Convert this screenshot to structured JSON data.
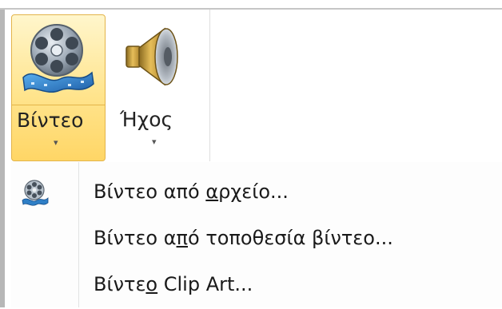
{
  "ribbon": {
    "video_button": {
      "label": "Βίντεο",
      "icon": "film-reel-icon",
      "dropdown_arrow": "▾",
      "state": "selected"
    },
    "audio_button": {
      "label": "Ήχος",
      "icon": "speaker-icon",
      "dropdown_arrow": "▾"
    }
  },
  "menu": {
    "items": [
      {
        "label_before": "Βίντεο από ",
        "label_mnemonic": "α",
        "label_after": "ρχείο...",
        "icon": "film-reel-small-icon"
      },
      {
        "label_before": "Βίντεο α",
        "label_mnemonic": "π",
        "label_after": "ό τοποθεσία βίντεο...",
        "icon": ""
      },
      {
        "label_before": "Βίντε",
        "label_mnemonic": "ο",
        "label_after": " Clip Art...",
        "icon": ""
      }
    ]
  },
  "colors": {
    "selected_fill": "#ffe48d",
    "selected_border": "#e3b44a",
    "film_reel": "#8a98a8",
    "film_strip": "#2f7fc6",
    "speaker": "#d9a93a"
  }
}
